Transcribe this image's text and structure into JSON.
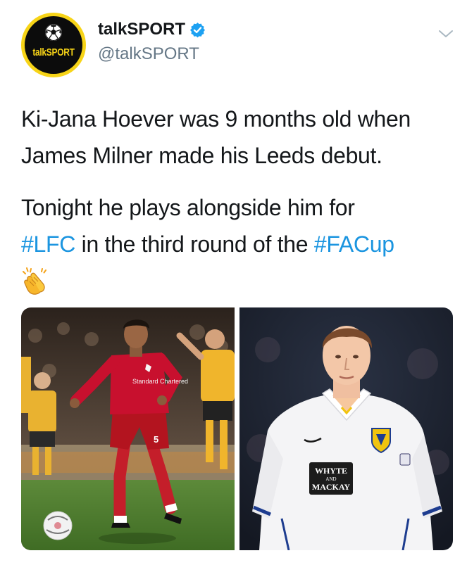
{
  "tweet": {
    "avatar": {
      "icon": "football-icon",
      "wordmark": "talkSPORT",
      "colors": {
        "ring": "#f7d417",
        "background": "#0c0c0c"
      }
    },
    "display_name": "talkSPORT",
    "verified_icon": "verified-badge-icon",
    "handle": "@talkSPORT",
    "menu_icon": "chevron-down-icon",
    "text": {
      "line1": "Ki-Jana Hoever was 9 months old when",
      "line2": "James Milner made his Leeds debut.",
      "line3": "Tonight he plays alongside him for",
      "hashtag_lfc": "#LFC",
      "middle": " in the third round of the ",
      "hashtag_facup": "#FACup",
      "emoji": "clapping-hands-emoji"
    },
    "media": {
      "left_photo": {
        "subject": "footballer-in-red-liverpool-kit",
        "shirt_sponsor": "Standard Chartered",
        "squad_number": "5"
      },
      "right_photo": {
        "subject": "footballer-in-white-leeds-kit",
        "shirt_sponsor_line1": "WHYTE",
        "shirt_sponsor_line2": "AND",
        "shirt_sponsor_line3": "MACKAY"
      }
    },
    "colors": {
      "link": "#1b95e0",
      "secondary_text": "#657786",
      "primary_text": "#14171a",
      "verified": "#1da1f2"
    }
  }
}
